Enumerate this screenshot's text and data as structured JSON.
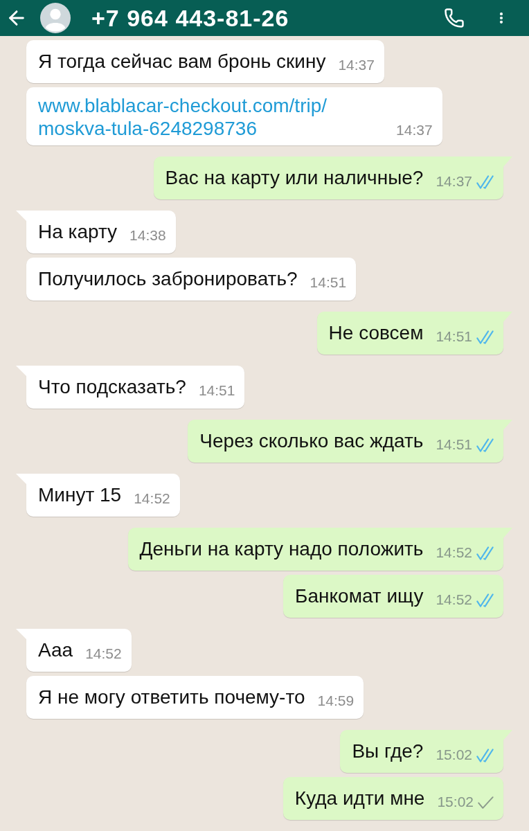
{
  "header": {
    "title": "+7 964 443-81-26"
  },
  "messages": [
    {
      "kind": "incoming",
      "text": "Я тогда сейчас вам бронь скину",
      "time": "14:37",
      "tail": false
    },
    {
      "kind": "incoming",
      "link_lines": [
        "www.blablacar-checkout.com/trip/",
        "moskva-tula-6248298736"
      ],
      "time": "14:37",
      "tail": false
    },
    {
      "kind": "outgoing",
      "text": "Вас на карту или наличные?",
      "time": "14:37",
      "tail": true,
      "read": true
    },
    {
      "kind": "incoming",
      "text": "На карту",
      "time": "14:38",
      "tail": true
    },
    {
      "kind": "incoming",
      "text": "Получилось забронировать?",
      "time": "14:51",
      "tail": false
    },
    {
      "kind": "outgoing",
      "text": "Не совсем",
      "time": "14:51",
      "tail": true,
      "read": true
    },
    {
      "kind": "incoming",
      "text": "Что подсказать?",
      "time": "14:51",
      "tail": true
    },
    {
      "kind": "outgoing",
      "text": "Через сколько вас ждать",
      "time": "14:51",
      "tail": true,
      "read": true
    },
    {
      "kind": "incoming",
      "text": "Минут 15",
      "time": "14:52",
      "tail": true
    },
    {
      "kind": "outgoing",
      "text": "Деньги на карту надо положить",
      "time": "14:52",
      "tail": true,
      "read": true
    },
    {
      "kind": "outgoing",
      "text": "Банкомат ищу",
      "time": "14:52",
      "tail": false,
      "read": true
    },
    {
      "kind": "incoming",
      "text": "Ааа",
      "time": "14:52",
      "tail": true
    },
    {
      "kind": "incoming",
      "text": "Я не могу ответить почему-то",
      "time": "14:59",
      "tail": false
    },
    {
      "kind": "outgoing",
      "text": "Вы где?",
      "time": "15:02",
      "tail": true,
      "read": true
    },
    {
      "kind": "outgoing",
      "text": "Куда идти мне",
      "time": "15:02",
      "tail": false,
      "read": false
    }
  ]
}
